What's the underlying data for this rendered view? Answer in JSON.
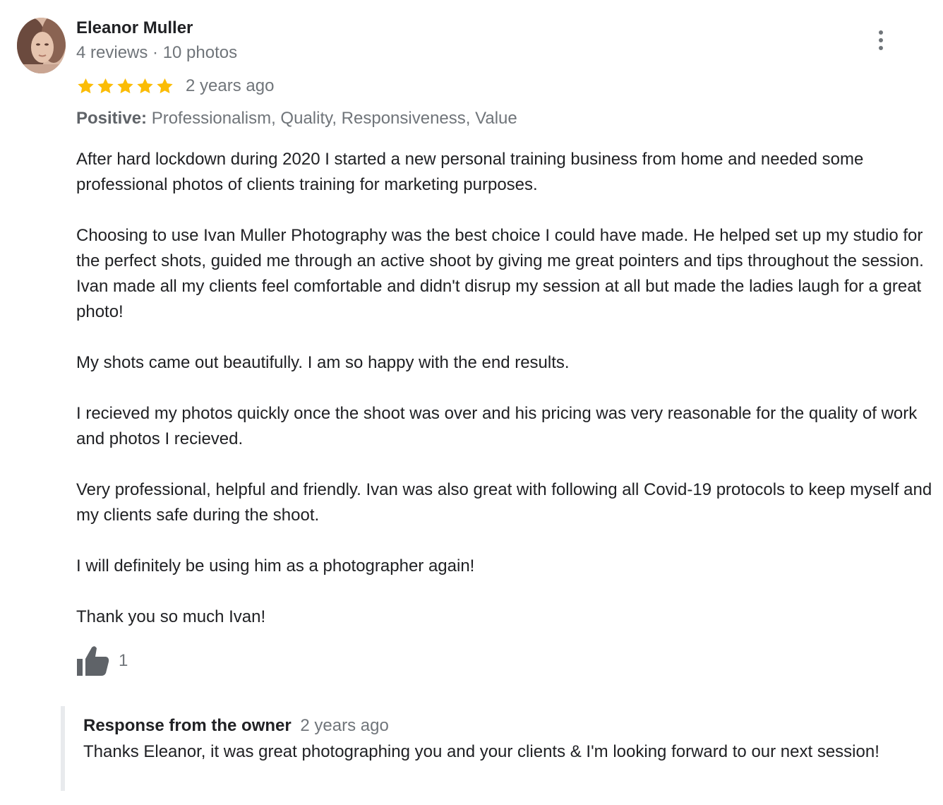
{
  "review": {
    "author": {
      "name": "Eleanor Muller",
      "meta": "4 reviews · 10 photos"
    },
    "rating": {
      "stars": 5,
      "max": 5,
      "color": "#fbbc04"
    },
    "time": "2 years ago",
    "attributes": {
      "label": "Positive:",
      "values": "Professionalism, Quality, Responsiveness, Value"
    },
    "paragraphs": [
      "After hard lockdown during 2020 I started a new personal training business from home and needed some professional photos of clients training for marketing purposes.",
      "Choosing to use Ivan Muller Photography was the best choice I could have made. He helped set up my studio for the perfect shots, guided me through an active shoot by giving me great pointers and tips throughout the session. Ivan made all my clients feel comfortable and didn't disrup my session at all but made the ladies laugh for a great photo!",
      "My shots came out beautifully. I am so happy with the end results.",
      "I recieved my photos quickly once the shoot was over and his pricing was very reasonable for the quality of work and photos I recieved.",
      "Very professional, helpful and friendly. Ivan was also great with following all Covid-19 protocols to keep myself and my clients safe during the shoot.",
      "I will definitely be using him as a photographer again!",
      "Thank you so much Ivan!"
    ],
    "likes": {
      "icon": "thumbs-up-icon",
      "count": "1"
    },
    "menu_icon": "more-vert-icon"
  },
  "owner_response": {
    "title": "Response from the owner",
    "time": "2 years ago",
    "text": "Thanks Eleanor, it was great photographing you and your clients & I'm looking forward to our next session!"
  }
}
